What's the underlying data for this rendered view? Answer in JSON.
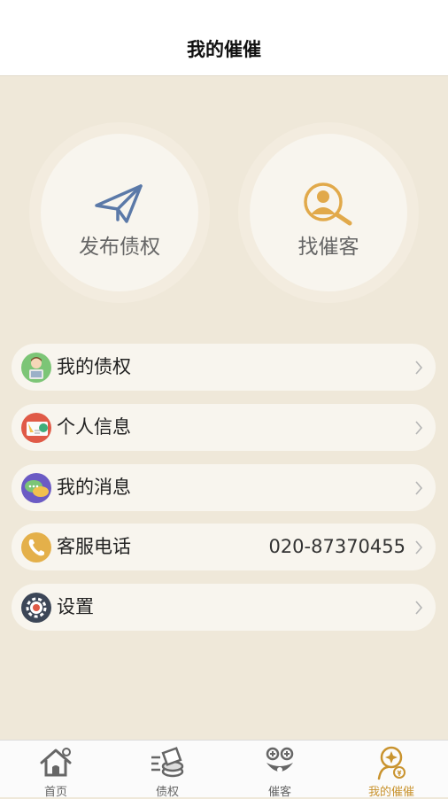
{
  "header": {
    "title": "我的催催"
  },
  "actions": [
    {
      "label": "发布债权",
      "icon": "paper-plane-icon"
    },
    {
      "label": "找催客",
      "icon": "person-search-icon"
    }
  ],
  "menu": [
    {
      "label": "我的债权",
      "icon": "user-avatar-icon",
      "value": ""
    },
    {
      "label": "个人信息",
      "icon": "id-card-icon",
      "value": ""
    },
    {
      "label": "我的消息",
      "icon": "chat-bubble-icon",
      "value": ""
    },
    {
      "label": "客服电话",
      "icon": "phone-icon",
      "value": "020-87370455"
    },
    {
      "label": "设置",
      "icon": "gear-icon",
      "value": ""
    }
  ],
  "tabbar": {
    "active": "我的催催",
    "items": [
      {
        "label": "首页",
        "icon": "home-icon"
      },
      {
        "label": "债权",
        "icon": "debt-icon"
      },
      {
        "label": "催客",
        "icon": "collector-face-icon"
      },
      {
        "label": "我的催催",
        "icon": "profile-star-icon"
      }
    ]
  },
  "colors": {
    "background": "#efe8d9",
    "accent": "#c9932e",
    "plane": "#5b79a8",
    "search": "#e1a94a"
  }
}
